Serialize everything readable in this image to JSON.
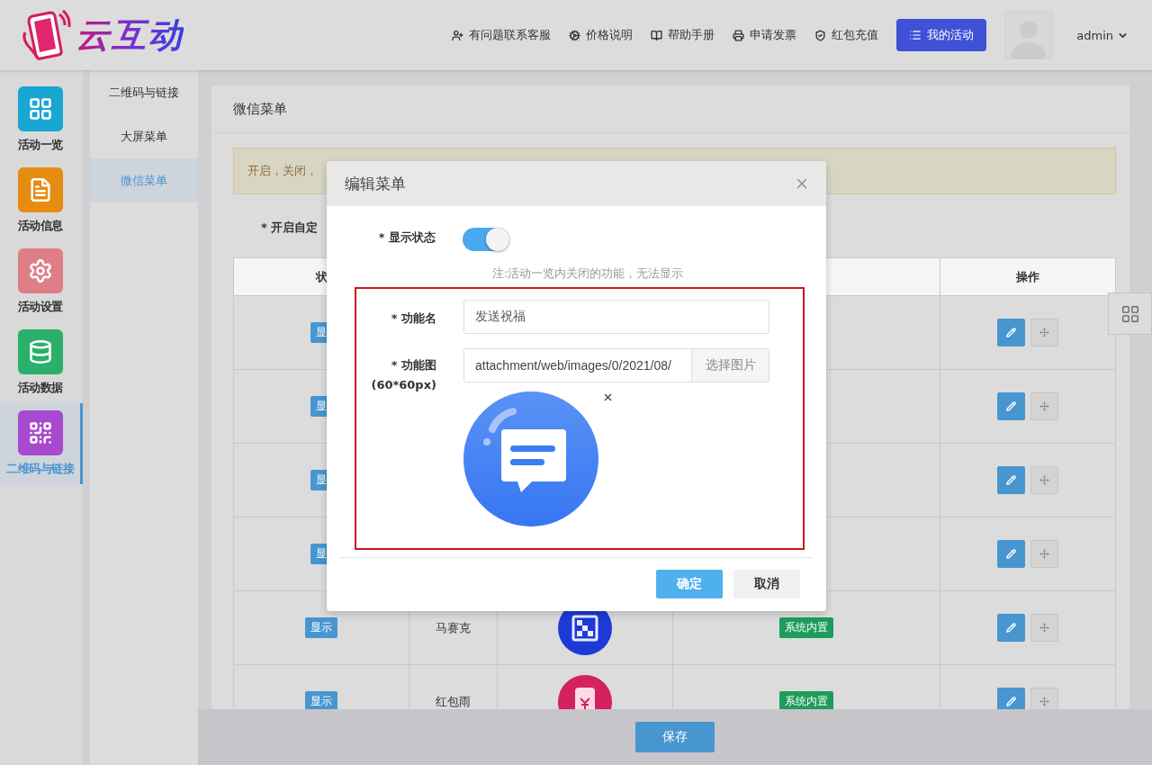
{
  "header": {
    "logo": "云互动",
    "links": [
      {
        "label": "有问题联系客服"
      },
      {
        "label": "价格说明"
      },
      {
        "label": "帮助手册"
      },
      {
        "label": "申请发票"
      },
      {
        "label": "红包充值"
      }
    ],
    "primary_button": "我的活动",
    "user": "admin"
  },
  "sidebar": {
    "items": [
      {
        "label": "活动一览",
        "color": "#18a6d2",
        "selected": false
      },
      {
        "label": "活动信息",
        "color": "#e68c10",
        "selected": false
      },
      {
        "label": "活动设置",
        "color": "#e07e88",
        "selected": false
      },
      {
        "label": "活动数据",
        "color": "#2bb06c",
        "selected": false
      },
      {
        "label": "二维码与链接",
        "color": "#a84ad0",
        "selected": true
      }
    ]
  },
  "subnav": {
    "items": [
      {
        "label": "二维码与链接",
        "selected": false
      },
      {
        "label": "大屏菜单",
        "selected": false
      },
      {
        "label": "微信菜单",
        "selected": true
      }
    ]
  },
  "panel": {
    "title": "微信菜单",
    "alert": "开启，关闭，",
    "switch_label": "* 开启自定"
  },
  "table": {
    "columns": {
      "status": "状",
      "actions": "操作"
    },
    "rows": [
      {
        "status": "显"
      },
      {
        "status": "显"
      },
      {
        "status": "显"
      },
      {
        "status": "显"
      },
      {
        "status": "显示",
        "name": "马赛克",
        "type": "系统内置"
      },
      {
        "status": "显示",
        "name": "红包雨",
        "type": "系统内置"
      }
    ]
  },
  "save_button": "保存",
  "modal": {
    "title": "编辑菜单",
    "fields": [
      {
        "kind": "toggle",
        "label": "* 显示状态",
        "on": true,
        "note": "注:活动一览内关闭的功能，无法显示"
      }
    ],
    "highlighted_fields": [
      {
        "kind": "text",
        "label": "* 功能名",
        "value": "发送祝福"
      },
      {
        "kind": "image",
        "label": "* 功能图",
        "sublabel": "(60*60px)",
        "value": "attachment/web/images/0/2021/08/",
        "button": "选择图片"
      }
    ],
    "buttons": [
      {
        "label": "确定",
        "kind": "primary"
      },
      {
        "label": "取消",
        "kind": "default"
      }
    ]
  }
}
